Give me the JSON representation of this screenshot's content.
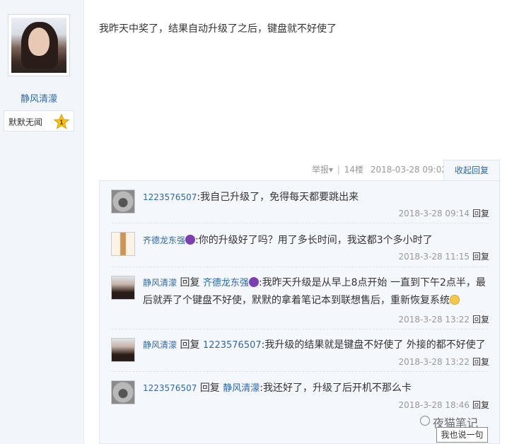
{
  "post": {
    "author": {
      "name": "静风清濛",
      "rank_title": "默默无闻",
      "rank_level": "1"
    },
    "content": "我昨天中奖了，结果自动升级了之后，键盘就不好使了",
    "meta": {
      "report_label": "举报",
      "floor": "14楼",
      "time": "2018-03-28 09:02",
      "collapse_label": "收起回复"
    }
  },
  "replies": [
    {
      "user": "1223576507",
      "avatar_icon": "koala-avatar",
      "text": ":我自己升级了，免得每天都要跳出来",
      "time": "2018-3-28 09:14",
      "reply_label": "回复"
    },
    {
      "user": "齐德龙东强",
      "avatar_icon": "statue-avatar",
      "user_suffix_emoji": "devil-emoji",
      "text": ":你的升级好了吗？用了多长时间，我这都3个多小时了",
      "time": "2018-3-28 11:15",
      "reply_label": "回复"
    },
    {
      "user": "静风清濛",
      "avatar_icon": "girl-avatar",
      "reply_word": "回复",
      "target": "齐德龙东强",
      "text_line1": ":我昨天升级是从早上8点开始 一直到下午2点半，最",
      "text_line2": "后就弄了个键盘不好使，默默的拿着笔记本到联想售后，重新恢复系统",
      "time": "2018-3-28 13:22",
      "reply_label": "回复"
    },
    {
      "user": "静风清濛",
      "avatar_icon": "girl-avatar",
      "reply_word": "回复",
      "target": "1223576507",
      "text": ":我升级的结果就是键盘不好使了 外接的都不好使了",
      "time": "2018-3-28 13:22",
      "reply_label": "回复"
    },
    {
      "user": "1223576507",
      "avatar_icon": "koala-avatar",
      "reply_word": "回复",
      "target": "静风清濛",
      "text": ":我还好了，升级了后开机不那么卡",
      "time": "2018-3-28 18:46",
      "reply_label": "回复"
    }
  ],
  "footer": {
    "say_button": "我也说一句",
    "watermark": "夜猫笔记"
  },
  "colors": {
    "link_blue": "#2e68a6",
    "sidebar_bg": "#f2f6fa",
    "reply_bg": "#f4f7fb"
  }
}
